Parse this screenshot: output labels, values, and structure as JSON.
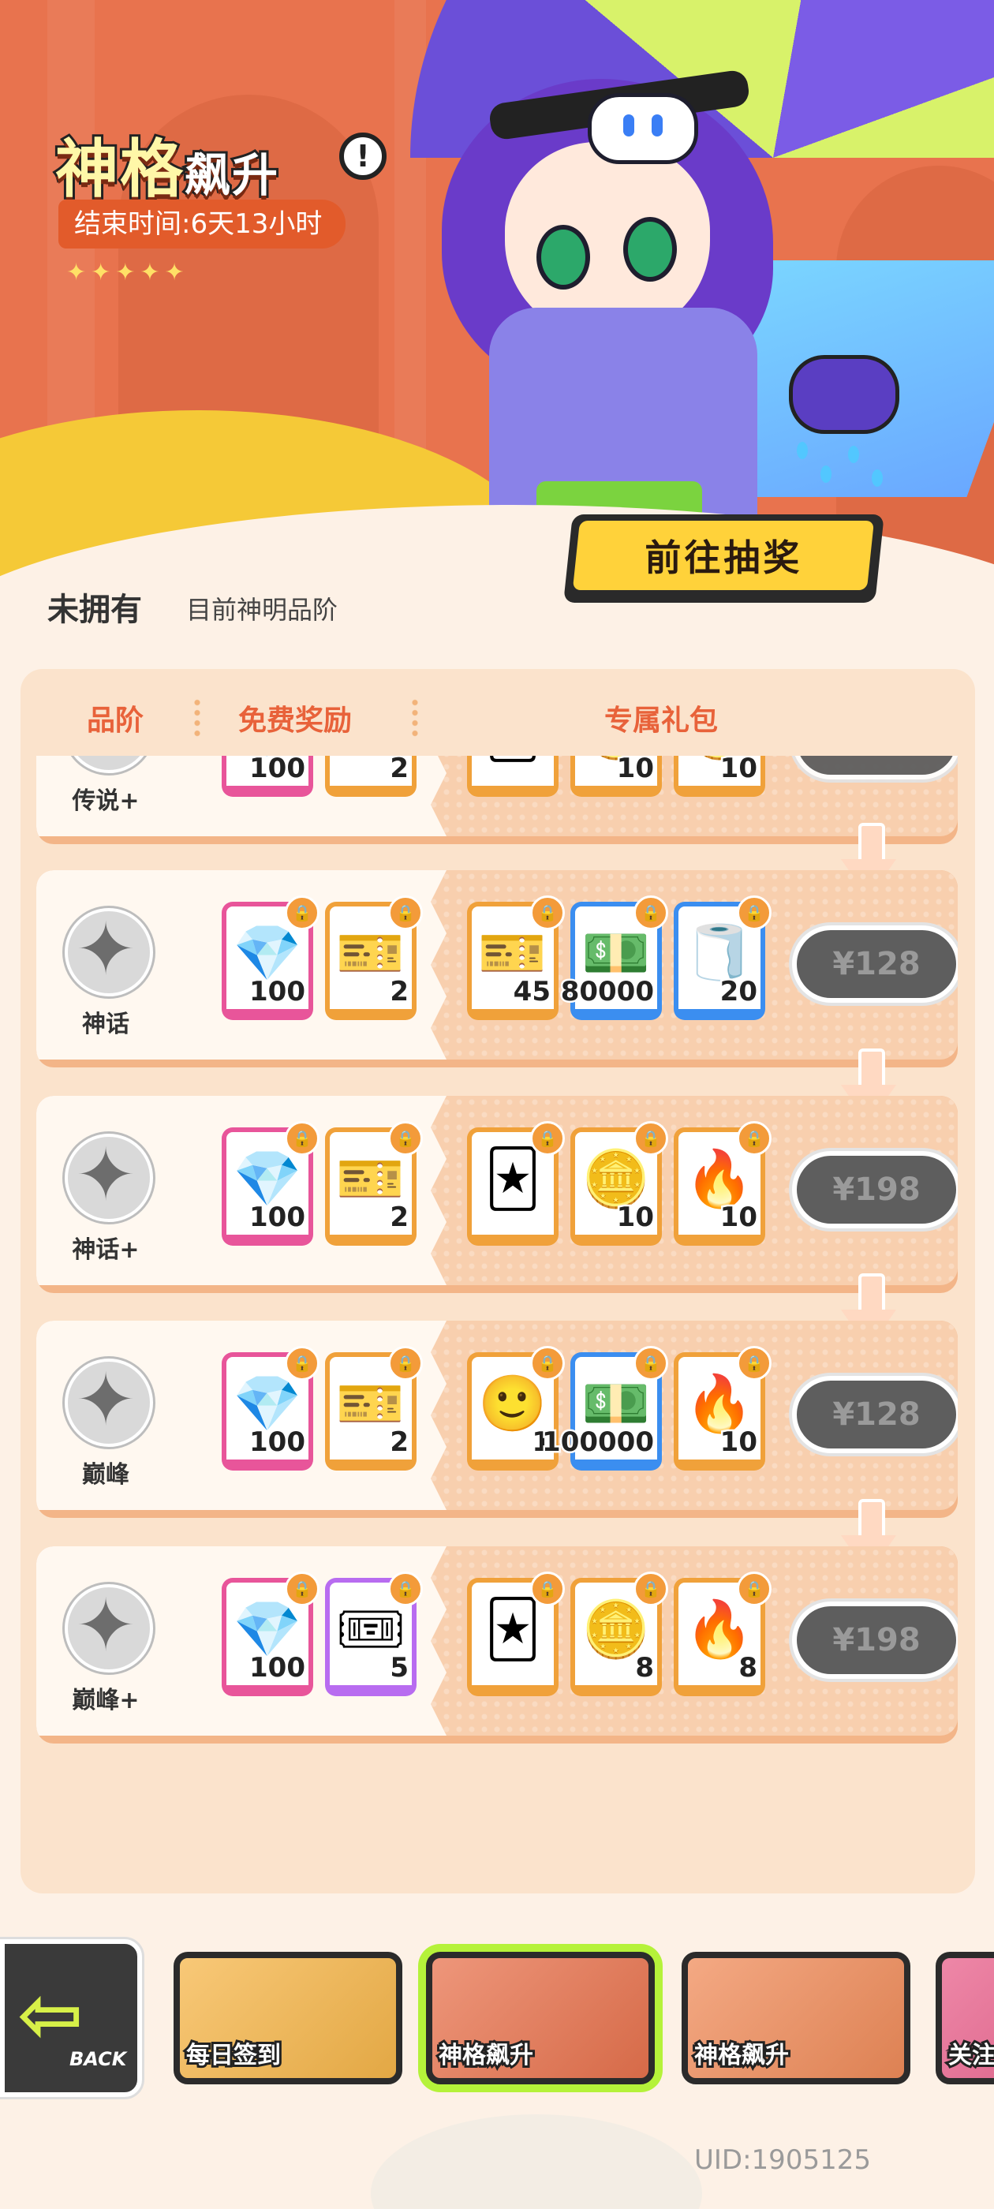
{
  "event": {
    "title_main": "神格",
    "title_sub": "飙升",
    "end_time": "结束时间:6天13小时",
    "stars": "✦✦✦✦✦",
    "draw_button": "前往抽奖",
    "status": "未拥有",
    "status_sub": "目前神明品阶"
  },
  "table": {
    "headers": [
      "品阶",
      "免费奖励",
      "专属礼包"
    ],
    "rows": [
      {
        "tier": "传说+",
        "free": [
          {
            "icon": "diamond",
            "qty": "100",
            "color": "pink"
          },
          {
            "icon": "ticket",
            "qty": "2",
            "color": "orange"
          }
        ],
        "pack": [
          {
            "icon": "card",
            "qty": "",
            "color": "orange"
          },
          {
            "icon": "coin",
            "qty": "10",
            "color": "orange"
          },
          {
            "icon": "coin",
            "qty": "10",
            "color": "orange"
          }
        ],
        "price": ""
      },
      {
        "tier": "神话",
        "free": [
          {
            "icon": "diamond",
            "qty": "100",
            "color": "pink"
          },
          {
            "icon": "ticket",
            "qty": "2",
            "color": "orange"
          }
        ],
        "pack": [
          {
            "icon": "ticket",
            "qty": "45",
            "color": "orange"
          },
          {
            "icon": "cash",
            "qty": "80000",
            "color": "blue"
          },
          {
            "icon": "tape",
            "qty": "20",
            "color": "blue"
          }
        ],
        "price": "¥128"
      },
      {
        "tier": "神话+",
        "free": [
          {
            "icon": "diamond",
            "qty": "100",
            "color": "pink"
          },
          {
            "icon": "ticket",
            "qty": "2",
            "color": "orange"
          }
        ],
        "pack": [
          {
            "icon": "card",
            "qty": "",
            "color": "orange"
          },
          {
            "icon": "coin",
            "qty": "10",
            "color": "orange"
          },
          {
            "icon": "fire",
            "qty": "10",
            "color": "orange"
          }
        ],
        "price": "¥198"
      },
      {
        "tier": "巅峰",
        "free": [
          {
            "icon": "diamond",
            "qty": "100",
            "color": "pink"
          },
          {
            "icon": "ticket",
            "qty": "2",
            "color": "orange"
          }
        ],
        "pack": [
          {
            "icon": "avatar",
            "qty": "1",
            "color": "orange"
          },
          {
            "icon": "cash",
            "qty": "100000",
            "color": "blue"
          },
          {
            "icon": "fire",
            "qty": "10",
            "color": "orange"
          }
        ],
        "price": "¥128"
      },
      {
        "tier": "巅峰+",
        "free": [
          {
            "icon": "diamond",
            "qty": "100",
            "color": "pink"
          },
          {
            "icon": "ticket-rainbow",
            "qty": "5",
            "color": "rainbow"
          }
        ],
        "pack": [
          {
            "icon": "card",
            "qty": "",
            "color": "orange"
          },
          {
            "icon": "coin",
            "qty": "8",
            "color": "orange"
          },
          {
            "icon": "fire",
            "qty": "8",
            "color": "orange"
          }
        ],
        "price": "¥198"
      }
    ]
  },
  "icons": {
    "diamond": "💎",
    "ticket": "🎫",
    "ticket-rainbow": "🎟",
    "card": "🃏",
    "coin": "🪙",
    "cash": "💵",
    "tape": "🧻",
    "fire": "🔥",
    "avatar": "🙂",
    "lock": "🔒",
    "badge": "✦"
  },
  "tabs": [
    {
      "label": "每日签到",
      "bg": "#f6b64a"
    },
    {
      "label": "神格飙升",
      "bg": "#e8734e",
      "active": true
    },
    {
      "label": "神格飙升",
      "bg": "#f08c5a"
    },
    {
      "label": "关注",
      "bg": "#e85f8a"
    }
  ],
  "back": {
    "label": "BACK"
  },
  "uid": "UID:1905125",
  "colors": {
    "accent": "#ffd23a",
    "header_text": "#e8623a",
    "price_bg": "#5e5e5e",
    "active_tab": "#b5f23a"
  }
}
